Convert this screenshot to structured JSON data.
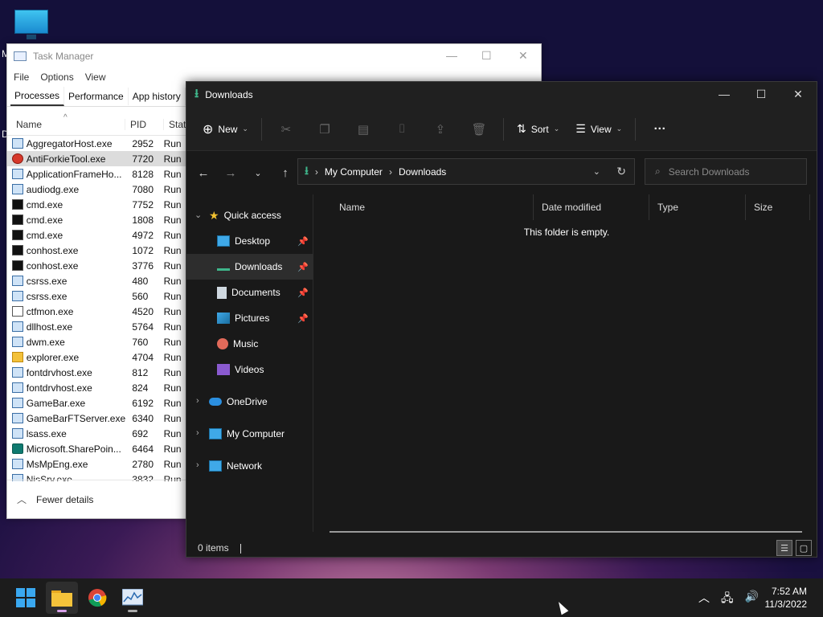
{
  "desktop": {
    "side_text_1": "M",
    "side_text_2": "D"
  },
  "task_manager": {
    "title": "Task Manager",
    "menu": [
      "File",
      "Options",
      "View"
    ],
    "tabs": [
      "Processes",
      "Performance",
      "App history"
    ],
    "columns": {
      "name": "Name",
      "pid": "PID",
      "status": "Stat"
    },
    "rows": [
      {
        "name": "AggregatorHost.exe",
        "pid": "2952",
        "status": "Run",
        "icon": "window-icon"
      },
      {
        "name": "AntiForkieTool.exe",
        "pid": "7720",
        "status": "Run",
        "icon": "red-circle-icon",
        "selected": true
      },
      {
        "name": "ApplicationFrameHo...",
        "pid": "8128",
        "status": "Run",
        "icon": "window-icon"
      },
      {
        "name": "audiodg.exe",
        "pid": "7080",
        "status": "Run",
        "icon": "window-icon"
      },
      {
        "name": "cmd.exe",
        "pid": "7752",
        "status": "Run",
        "icon": "console-icon"
      },
      {
        "name": "cmd.exe",
        "pid": "1808",
        "status": "Run",
        "icon": "console-icon"
      },
      {
        "name": "cmd.exe",
        "pid": "4972",
        "status": "Run",
        "icon": "console-icon"
      },
      {
        "name": "conhost.exe",
        "pid": "1072",
        "status": "Run",
        "icon": "console-icon"
      },
      {
        "name": "conhost.exe",
        "pid": "3776",
        "status": "Run",
        "icon": "console-icon"
      },
      {
        "name": "csrss.exe",
        "pid": "480",
        "status": "Run",
        "icon": "window-icon"
      },
      {
        "name": "csrss.exe",
        "pid": "560",
        "status": "Run",
        "icon": "window-icon"
      },
      {
        "name": "ctfmon.exe",
        "pid": "4520",
        "status": "Run",
        "icon": "pen-icon"
      },
      {
        "name": "dllhost.exe",
        "pid": "5764",
        "status": "Run",
        "icon": "window-icon"
      },
      {
        "name": "dwm.exe",
        "pid": "760",
        "status": "Run",
        "icon": "window-icon"
      },
      {
        "name": "explorer.exe",
        "pid": "4704",
        "status": "Run",
        "icon": "folder-icon"
      },
      {
        "name": "fontdrvhost.exe",
        "pid": "812",
        "status": "Run",
        "icon": "window-icon"
      },
      {
        "name": "fontdrvhost.exe",
        "pid": "824",
        "status": "Run",
        "icon": "window-icon"
      },
      {
        "name": "GameBar.exe",
        "pid": "6192",
        "status": "Run",
        "icon": "window-icon"
      },
      {
        "name": "GameBarFTServer.exe",
        "pid": "6340",
        "status": "Run",
        "icon": "window-icon"
      },
      {
        "name": "lsass.exe",
        "pid": "692",
        "status": "Run",
        "icon": "window-icon"
      },
      {
        "name": "Microsoft.SharePoin...",
        "pid": "6464",
        "status": "Run",
        "icon": "sharepoint-icon"
      },
      {
        "name": "MsMpEng.exe",
        "pid": "2780",
        "status": "Run",
        "icon": "window-icon"
      },
      {
        "name": "NisSrv.exe",
        "pid": "3832",
        "status": "Run",
        "icon": "window-icon"
      }
    ],
    "footer": "Fewer details"
  },
  "explorer": {
    "title": "Downloads",
    "toolbar": {
      "new": "New",
      "sort": "Sort",
      "view": "View"
    },
    "address": {
      "root": "My Computer",
      "current": "Downloads"
    },
    "search_placeholder": "Search Downloads",
    "sidebar": {
      "quick_access": "Quick access",
      "items": [
        {
          "label": "Desktop",
          "pinned": true
        },
        {
          "label": "Downloads",
          "pinned": true,
          "selected": true
        },
        {
          "label": "Documents",
          "pinned": true
        },
        {
          "label": "Pictures",
          "pinned": true
        },
        {
          "label": "Music",
          "pinned": false
        },
        {
          "label": "Videos",
          "pinned": false
        }
      ],
      "onedrive": "OneDrive",
      "my_computer": "My Computer",
      "network": "Network"
    },
    "columns": {
      "name": "Name",
      "date": "Date modified",
      "type": "Type",
      "size": "Size"
    },
    "empty_message": "This folder is empty.",
    "status": "0 items"
  },
  "taskbar": {
    "clock": {
      "time": "7:52 AM",
      "date": "11/3/2022"
    }
  },
  "colors": {
    "accent_green": "#3fb68b",
    "selection_dark": "#2d2d2d"
  }
}
